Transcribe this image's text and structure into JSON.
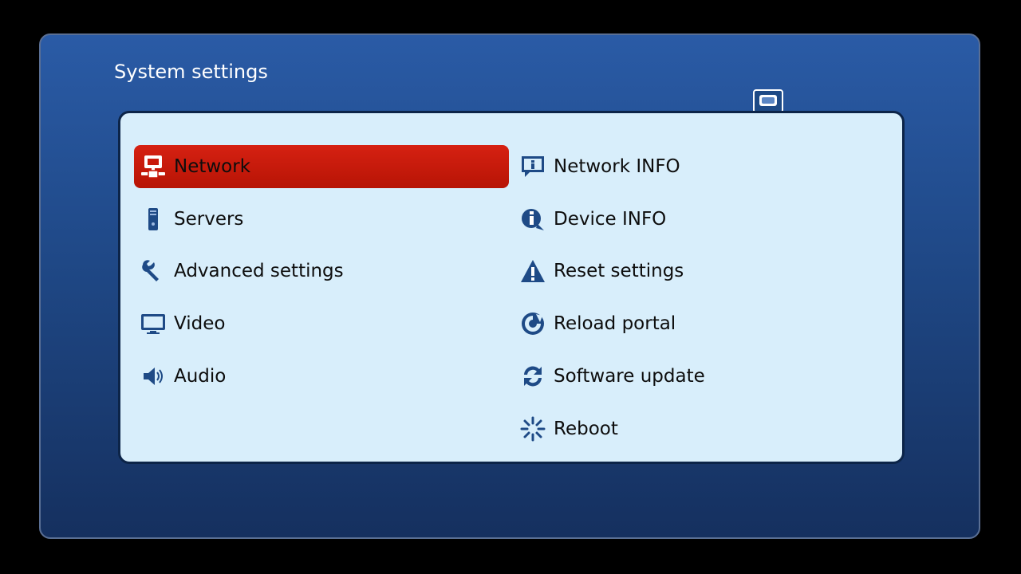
{
  "screen": {
    "title": "System settings",
    "header_icon": "network-icon"
  },
  "colors": {
    "frame_top": "#2a5ba6",
    "frame_bottom": "#15305f",
    "panel": "#d8eefb",
    "selected": "#c81a0b",
    "icon": "#1e4a86"
  },
  "menu": {
    "left": [
      {
        "label": "Network",
        "icon": "network-icon",
        "selected": true
      },
      {
        "label": "Servers",
        "icon": "server-icon",
        "selected": false
      },
      {
        "label": "Advanced settings",
        "icon": "wrench-icon",
        "selected": false
      },
      {
        "label": "Video",
        "icon": "monitor-icon",
        "selected": false
      },
      {
        "label": "Audio",
        "icon": "speaker-icon",
        "selected": false
      }
    ],
    "right": [
      {
        "label": "Network INFO",
        "icon": "info-bubble-icon",
        "selected": false
      },
      {
        "label": "Device INFO",
        "icon": "info-icon",
        "selected": false
      },
      {
        "label": "Reset settings",
        "icon": "warning-icon",
        "selected": false
      },
      {
        "label": "Reload portal",
        "icon": "reload-portal-icon",
        "selected": false
      },
      {
        "label": "Software update",
        "icon": "refresh-icon",
        "selected": false
      },
      {
        "label": "Reboot",
        "icon": "reboot-spinner-icon",
        "selected": false
      }
    ]
  }
}
